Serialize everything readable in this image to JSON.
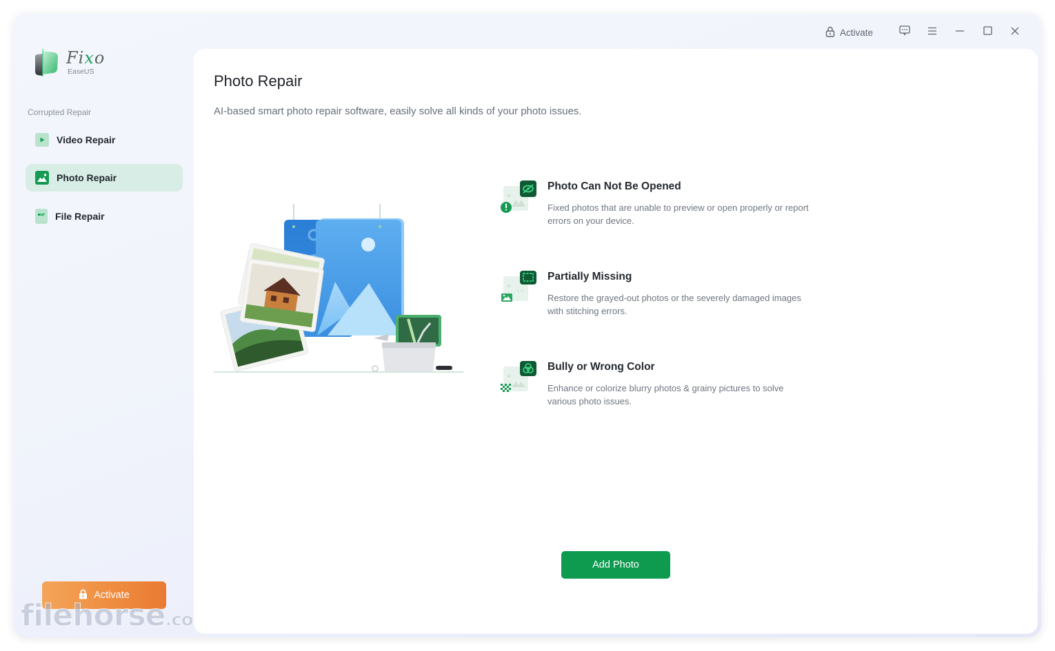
{
  "app": {
    "name": "Fixo",
    "vendor": "EaseUS"
  },
  "titlebar": {
    "activate_label": "Activate",
    "icons": [
      "lock-icon",
      "feedback-icon",
      "menu-icon",
      "minimize-icon",
      "maximize-icon",
      "close-icon"
    ]
  },
  "sidebar": {
    "section_label": "Corrupted Repair",
    "items": [
      {
        "label": "Video Repair",
        "icon": "video-icon",
        "active": false
      },
      {
        "label": "Photo Repair",
        "icon": "photo-icon",
        "active": true
      },
      {
        "label": "File Repair",
        "icon": "file-icon",
        "active": false
      }
    ],
    "activate_label": "Activate"
  },
  "main": {
    "title": "Photo Repair",
    "subtitle": "AI-based smart photo repair software, easily solve all kinds of your photo issues.",
    "features": [
      {
        "title": "Photo Can Not Be Opened",
        "description": "Fixed photos that are unable to preview or open properly or report errors on your device.",
        "icon": "hidden-eye-icon"
      },
      {
        "title": "Partially Missing",
        "description": "Restore the grayed-out photos or the severely damaged images with stitching errors.",
        "icon": "crop-frame-icon"
      },
      {
        "title": "Bully or Wrong Color",
        "description": "Enhance or colorize blurry photos & grainy pictures to solve various photo issues.",
        "icon": "color-circles-icon"
      }
    ],
    "add_button_label": "Add Photo"
  },
  "watermark": {
    "text": "filehorse",
    "suffix": ".com"
  },
  "colors": {
    "accent_green": "#0e9a4f",
    "dark_green": "#0f5a33",
    "activate_orange": "#ee8b3e",
    "active_nav_bg": "#d8ede6"
  }
}
